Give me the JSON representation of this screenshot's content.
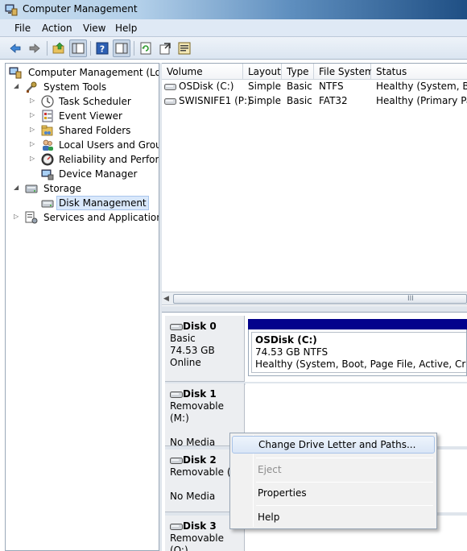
{
  "window": {
    "title": "Computer Management"
  },
  "menu": {
    "file": "File",
    "action": "Action",
    "view": "View",
    "help": "Help"
  },
  "toolbar": {
    "buttons": [
      "back-arrow-icon",
      "forward-arrow-icon",
      "up-folder-icon",
      "show-hide-tree-icon",
      "help-icon",
      "show-action-pane-icon",
      "refresh-icon",
      "export-list-icon",
      "properties-icon"
    ]
  },
  "tree": {
    "root": "Computer Management (Local",
    "system_tools": "System Tools",
    "task_scheduler": "Task Scheduler",
    "event_viewer": "Event Viewer",
    "shared_folders": "Shared Folders",
    "local_users": "Local Users and Groups",
    "reliability": "Reliability and Performa",
    "device_manager": "Device Manager",
    "storage": "Storage",
    "disk_management": "Disk Management",
    "services": "Services and Applications"
  },
  "volume_list": {
    "columns": [
      "Volume",
      "Layout",
      "Type",
      "File System",
      "Status"
    ],
    "rows": [
      [
        "OSDisk (C:)",
        "Simple",
        "Basic",
        "NTFS",
        "Healthy (System, Boo"
      ],
      [
        "SWISNIFE1 (P:)",
        "Simple",
        "Basic",
        "FAT32",
        "Healthy (Primary Part"
      ]
    ],
    "scroll_grip": "III"
  },
  "disks": [
    {
      "name": "Disk 0",
      "type": "Basic",
      "size": "74.53 GB",
      "state": "Online",
      "partition": {
        "name": "OSDisk  (C:)",
        "size_fs": "74.53 GB NTFS",
        "status": "Healthy (System, Boot, Page File, Active, Crash Dum"
      }
    },
    {
      "name": "Disk 1",
      "type": "Removable (M:)",
      "state": "No Media"
    },
    {
      "name": "Disk 2",
      "type": "Removable (N",
      "state": "No Media"
    },
    {
      "name": "Disk 3",
      "type": "Removable (O:)"
    }
  ],
  "context_menu": {
    "change_drive": "Change Drive Letter and Paths...",
    "eject": "Eject",
    "properties": "Properties",
    "help": "Help"
  },
  "colors": {
    "partition_bar": "#03028c",
    "selection": "#d9e8fb"
  }
}
